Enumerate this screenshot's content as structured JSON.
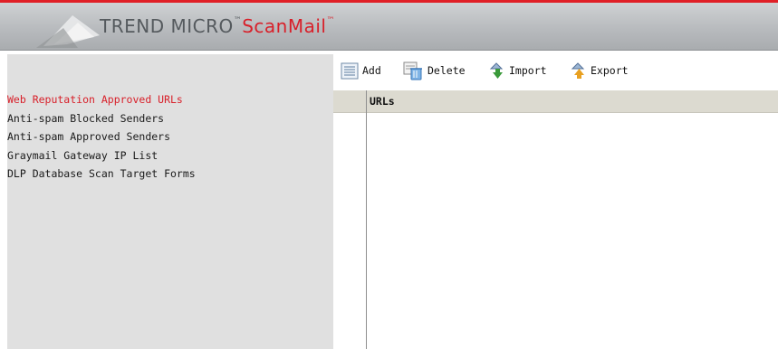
{
  "header": {
    "brand_main": "TREND MICRO",
    "brand_tm": "™",
    "product": "ScanMail",
    "product_tm": "™"
  },
  "sidebar": {
    "items": [
      {
        "label": "Web Reputation Approved URLs",
        "active": true
      },
      {
        "label": "Anti-spam Blocked Senders",
        "active": false
      },
      {
        "label": "Anti-spam Approved Senders",
        "active": false
      },
      {
        "label": "Graymail Gateway IP List",
        "active": false
      },
      {
        "label": "DLP Database Scan Target Forms",
        "active": false
      }
    ]
  },
  "toolbar": {
    "add_label": "Add",
    "delete_label": "Delete",
    "import_label": "Import",
    "export_label": "Export"
  },
  "grid": {
    "column_header": "URLs"
  },
  "colors": {
    "accent_red": "#d8202a",
    "sidebar_bg": "#e0e0e0",
    "grid_header_bg": "#dcdad0"
  }
}
